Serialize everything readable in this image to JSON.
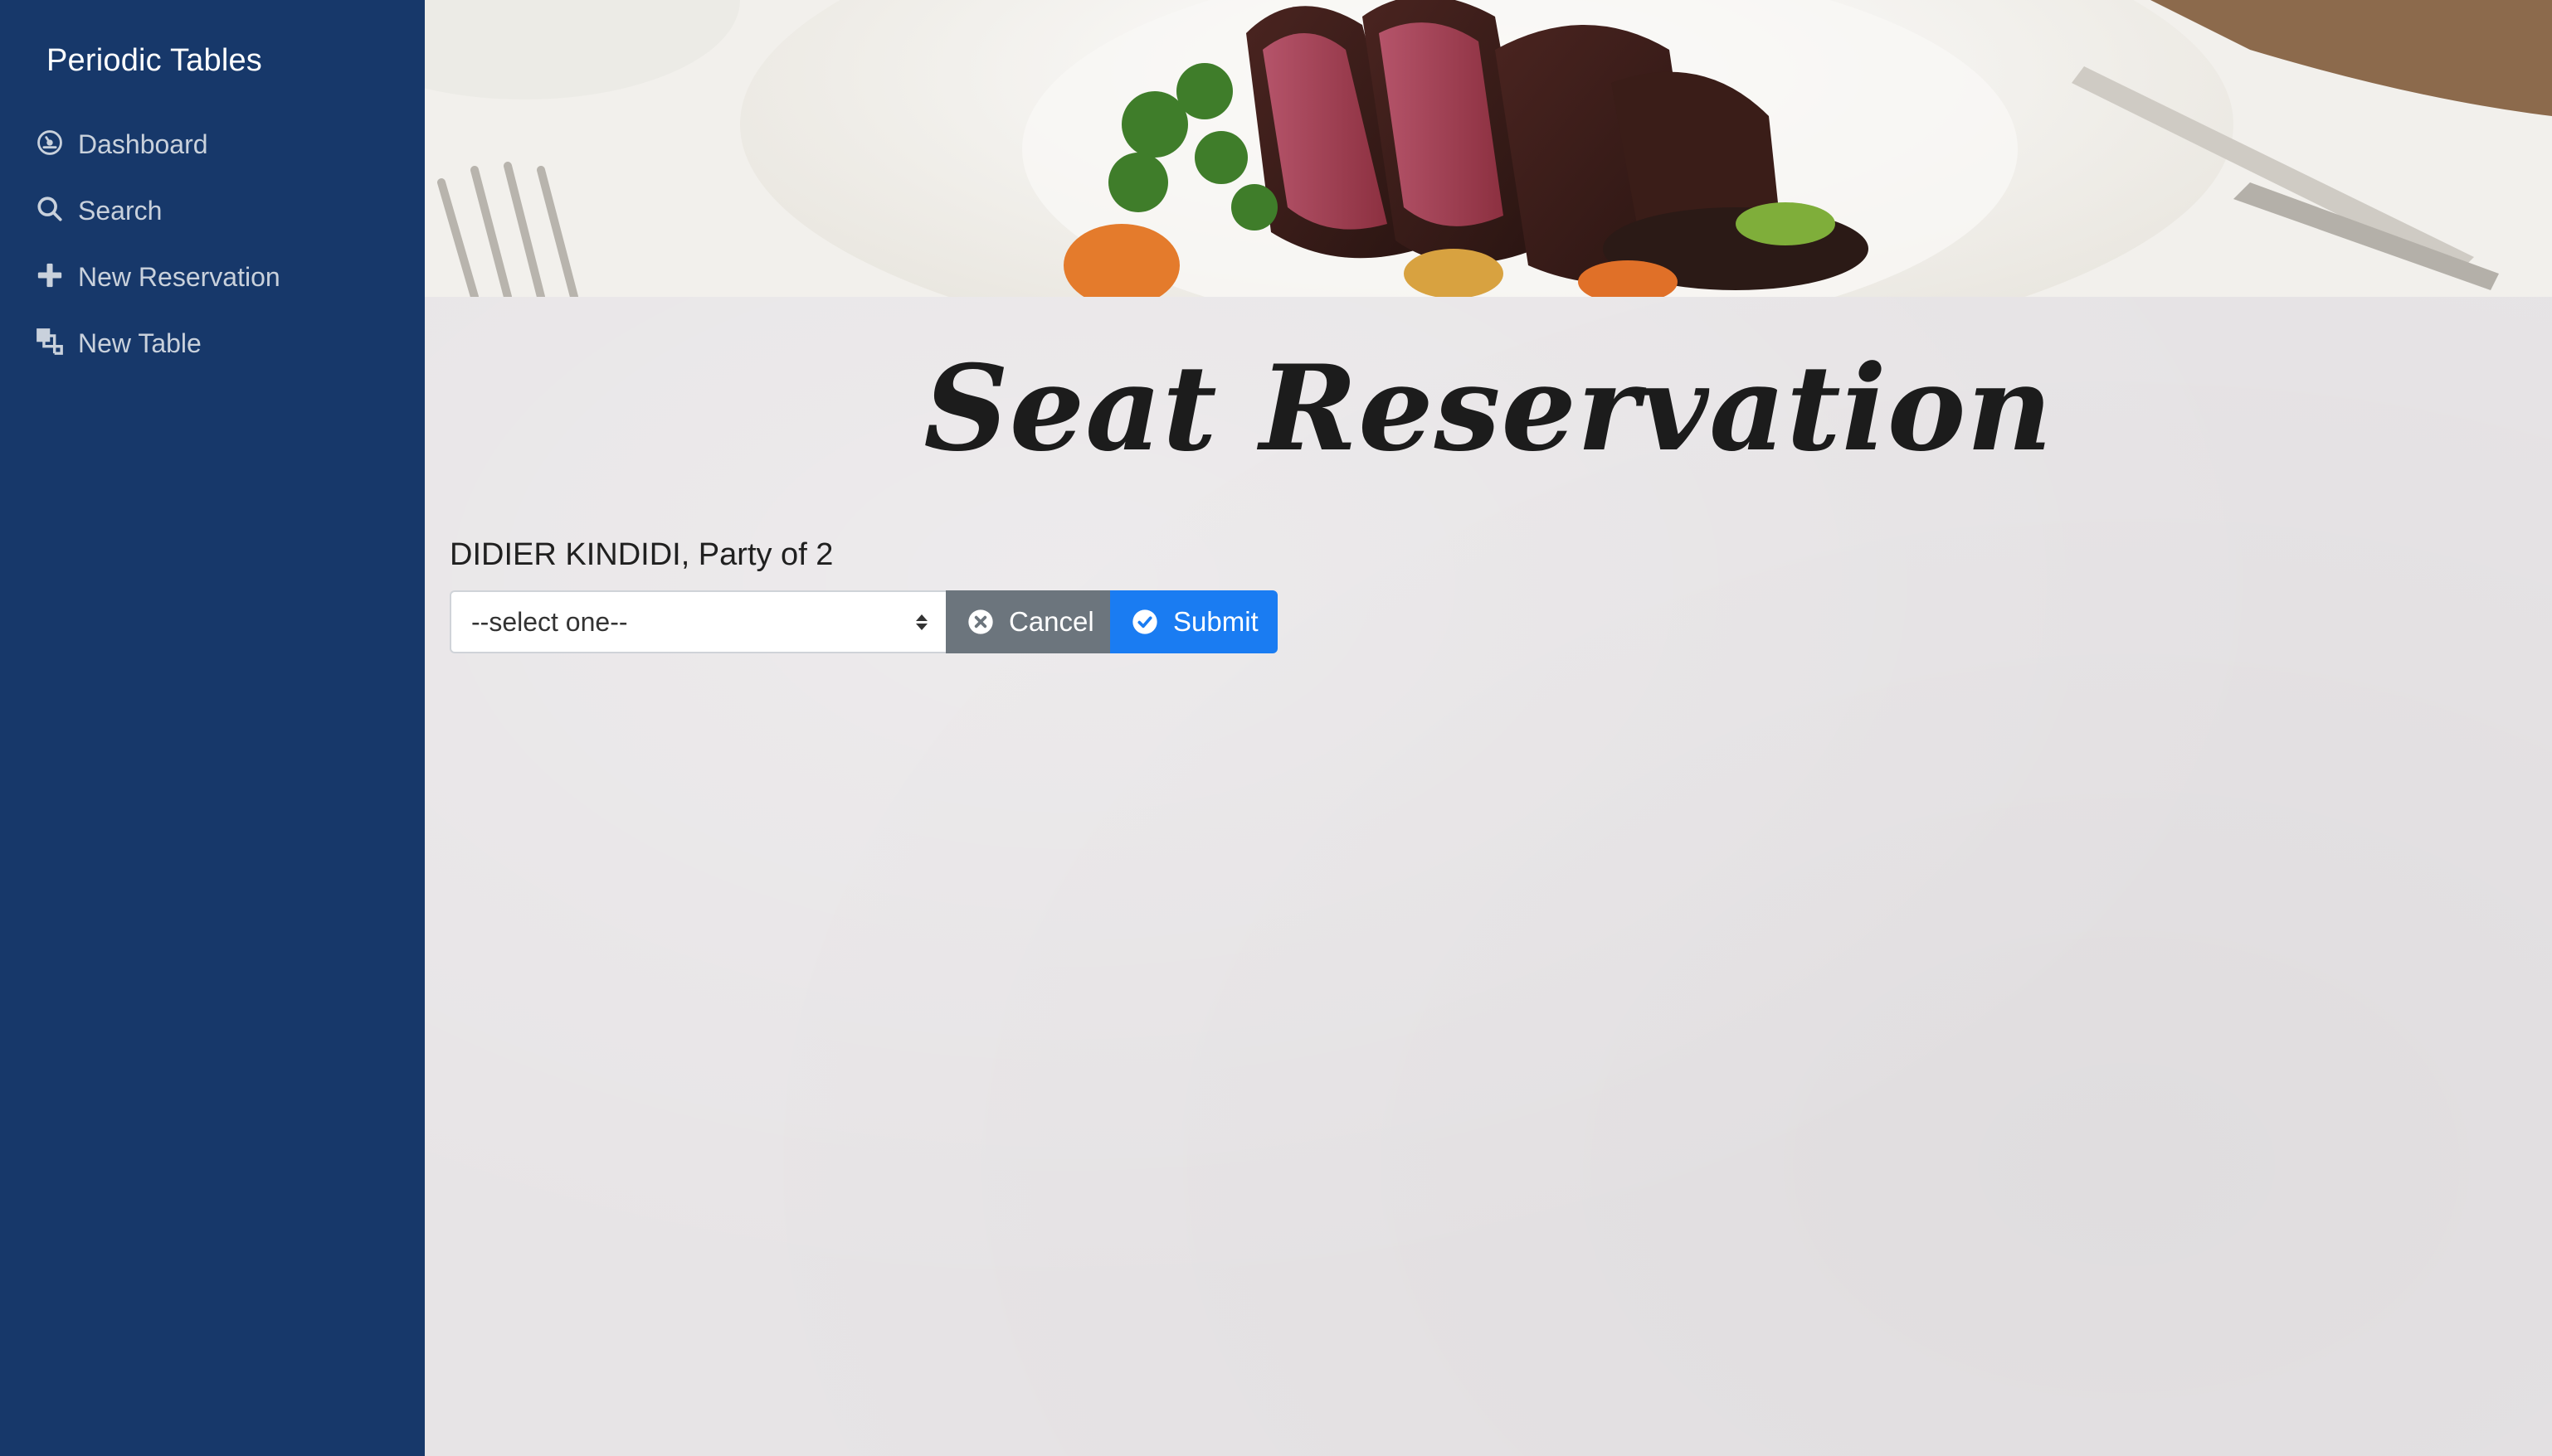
{
  "sidebar": {
    "brand": "Periodic Tables",
    "items": [
      {
        "label": "Dashboard",
        "icon": "dashboard-icon"
      },
      {
        "label": "Search",
        "icon": "search-icon"
      },
      {
        "label": "New Reservation",
        "icon": "plus-icon"
      },
      {
        "label": "New Table",
        "icon": "table-layers-icon"
      }
    ]
  },
  "main": {
    "hero_image": "food-plate-photo",
    "title": "Seat Reservation",
    "reservation_line": "DIDIER KINDIDI, Party of 2",
    "form": {
      "select_value": "--select one--",
      "cancel_label": "Cancel",
      "cancel_icon": "x-circle-icon",
      "submit_label": "Submit",
      "submit_icon": "check-circle-icon"
    }
  },
  "colors": {
    "sidebar_bg": "#17386a",
    "page_bg": "#e7e4e6",
    "cancel_bg": "#6c757d",
    "submit_bg": "#1a7cf2"
  }
}
